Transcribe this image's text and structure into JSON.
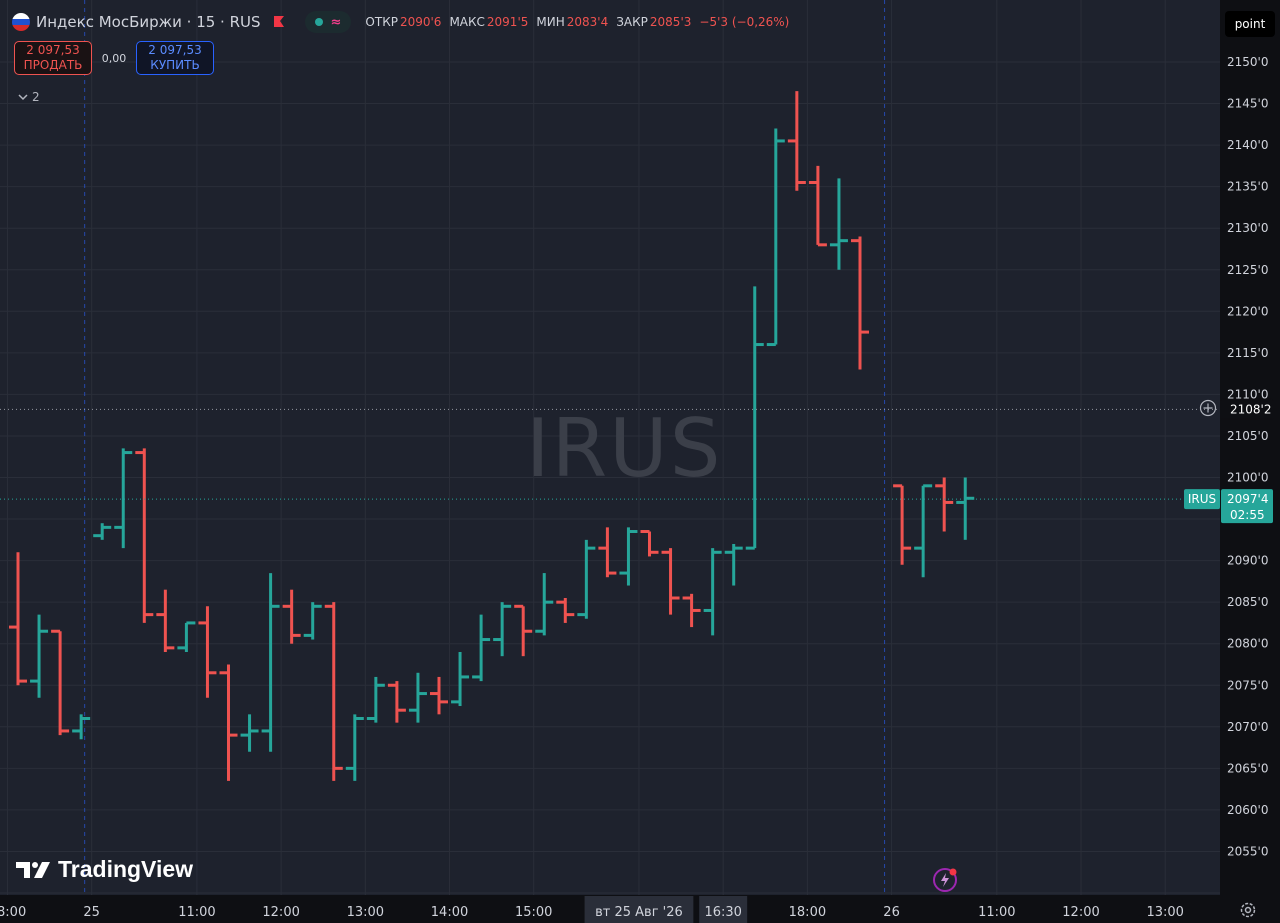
{
  "legend": {
    "title": "Индекс МосБиржи · 15 · RUS",
    "open_label": "ОТКР",
    "open_value": "2090'6",
    "high_label": "МАКС",
    "high_value": "2091'5",
    "low_label": "МИН",
    "low_value": "2083'4",
    "close_label": "ЗАКР",
    "close_value": "2085'3",
    "change": "−5'3 (−0,26%)"
  },
  "trade": {
    "sell_price": "2 097,53",
    "sell_label": "ПРОДАТЬ",
    "spread": "0,00",
    "buy_price": "2 097,53",
    "buy_label": "КУПИТЬ"
  },
  "indicators_toggle": "2",
  "watermark": "IRUS",
  "unit_button": "point",
  "logo_text": "TradingView",
  "colors": {
    "up": "#26a69a",
    "down": "#ef5350",
    "background": "#0e0f13",
    "grid": "#2a2e39",
    "text": "#d1d4dc"
  },
  "chart_data": {
    "type": "ohlc-bar",
    "y_axis": {
      "min": 2051,
      "max": 2152,
      "ticks": [
        2050,
        2055,
        2060,
        2065,
        2070,
        2075,
        2080,
        2085,
        2090,
        2095,
        2100,
        2105,
        2110,
        2115,
        2120,
        2125,
        2130,
        2135,
        2140,
        2145,
        2150
      ],
      "tick_labels": [
        "",
        "2055'0",
        "2060'0",
        "2065'0",
        "2070'0",
        "2075'0",
        "2080'0",
        "2085'0",
        "2090'0",
        "",
        "2100'0",
        "2105'0",
        "2110'0",
        "2115'0",
        "2120'0",
        "2125'0",
        "2130'0",
        "2135'0",
        "2140'0",
        "2145'0",
        "2150'0"
      ]
    },
    "x_axis": {
      "labels": [
        {
          "index": -0.5,
          "text": "18:00"
        },
        {
          "index": 3.5,
          "text": "25"
        },
        {
          "index": 8.5,
          "text": "11:00"
        },
        {
          "index": 12.5,
          "text": "12:00"
        },
        {
          "index": 16.5,
          "text": "13:00"
        },
        {
          "index": 20.5,
          "text": "14:00"
        },
        {
          "index": 24.5,
          "text": "15:00"
        },
        {
          "index": 29.5,
          "text": "вт 25 Авг '26",
          "highlight": true
        },
        {
          "index": 33.5,
          "text": "16:30",
          "highlight": true
        },
        {
          "index": 37.5,
          "text": "18:00"
        },
        {
          "index": 41.5,
          "text": "26"
        },
        {
          "index": 46.5,
          "text": "11:00"
        },
        {
          "index": 50.5,
          "text": "12:00"
        },
        {
          "index": 54.5,
          "text": "13:00"
        }
      ],
      "session_breaks": [
        3.5,
        41.5
      ]
    },
    "bars": [
      {
        "i": 0,
        "o": 2082.0,
        "h": 2091.0,
        "l": 2075.0,
        "c": 2075.5
      },
      {
        "i": 1,
        "o": 2075.5,
        "h": 2083.5,
        "l": 2073.5,
        "c": 2081.5
      },
      {
        "i": 2,
        "o": 2081.5,
        "h": 2081.5,
        "l": 2069.0,
        "c": 2069.5
      },
      {
        "i": 3,
        "o": 2069.5,
        "h": 2071.5,
        "l": 2068.5,
        "c": 2071.0
      },
      {
        "i": 4,
        "o": 2093.0,
        "h": 2094.5,
        "l": 2092.5,
        "c": 2094.0
      },
      {
        "i": 5,
        "o": 2094.0,
        "h": 2103.5,
        "l": 2091.5,
        "c": 2103.0
      },
      {
        "i": 6,
        "o": 2103.0,
        "h": 2103.5,
        "l": 2082.5,
        "c": 2083.5
      },
      {
        "i": 7,
        "o": 2083.5,
        "h": 2086.5,
        "l": 2079.0,
        "c": 2079.5
      },
      {
        "i": 8,
        "o": 2079.5,
        "h": 2082.5,
        "l": 2079.0,
        "c": 2082.5
      },
      {
        "i": 9,
        "o": 2082.5,
        "h": 2084.5,
        "l": 2073.5,
        "c": 2076.5
      },
      {
        "i": 10,
        "o": 2076.5,
        "h": 2077.5,
        "l": 2063.5,
        "c": 2069.0
      },
      {
        "i": 11,
        "o": 2069.0,
        "h": 2071.5,
        "l": 2067.0,
        "c": 2069.5
      },
      {
        "i": 12,
        "o": 2069.5,
        "h": 2088.5,
        "l": 2067.0,
        "c": 2084.5
      },
      {
        "i": 13,
        "o": 2084.5,
        "h": 2086.5,
        "l": 2080.0,
        "c": 2081.0
      },
      {
        "i": 14,
        "o": 2081.0,
        "h": 2085.0,
        "l": 2080.5,
        "c": 2084.5
      },
      {
        "i": 15,
        "o": 2084.5,
        "h": 2085.0,
        "l": 2063.5,
        "c": 2065.0
      },
      {
        "i": 16,
        "o": 2065.0,
        "h": 2071.5,
        "l": 2063.5,
        "c": 2071.0
      },
      {
        "i": 17,
        "o": 2071.0,
        "h": 2076.0,
        "l": 2070.5,
        "c": 2075.0
      },
      {
        "i": 18,
        "o": 2075.0,
        "h": 2075.5,
        "l": 2070.5,
        "c": 2072.0
      },
      {
        "i": 19,
        "o": 2072.0,
        "h": 2076.5,
        "l": 2070.5,
        "c": 2074.0
      },
      {
        "i": 20,
        "o": 2074.0,
        "h": 2076.0,
        "l": 2071.5,
        "c": 2073.0
      },
      {
        "i": 21,
        "o": 2073.0,
        "h": 2079.0,
        "l": 2072.5,
        "c": 2076.0
      },
      {
        "i": 22,
        "o": 2076.0,
        "h": 2083.5,
        "l": 2075.5,
        "c": 2080.5
      },
      {
        "i": 23,
        "o": 2080.5,
        "h": 2085.0,
        "l": 2078.5,
        "c": 2084.5
      },
      {
        "i": 24,
        "o": 2084.5,
        "h": 2084.5,
        "l": 2078.5,
        "c": 2081.5
      },
      {
        "i": 25,
        "o": 2081.5,
        "h": 2088.5,
        "l": 2081.0,
        "c": 2085.0
      },
      {
        "i": 26,
        "o": 2085.0,
        "h": 2085.5,
        "l": 2082.5,
        "c": 2083.5
      },
      {
        "i": 27,
        "o": 2083.5,
        "h": 2092.5,
        "l": 2083.0,
        "c": 2091.5
      },
      {
        "i": 28,
        "o": 2091.5,
        "h": 2094.0,
        "l": 2088.0,
        "c": 2088.5
      },
      {
        "i": 29,
        "o": 2088.5,
        "h": 2094.0,
        "l": 2087.0,
        "c": 2093.5
      },
      {
        "i": 30,
        "o": 2093.5,
        "h": 2093.5,
        "l": 2090.5,
        "c": 2091.0
      },
      {
        "i": 31,
        "o": 2091.0,
        "h": 2091.5,
        "l": 2083.5,
        "c": 2085.5
      },
      {
        "i": 32,
        "o": 2085.5,
        "h": 2086.0,
        "l": 2082.0,
        "c": 2084.0
      },
      {
        "i": 33,
        "o": 2084.0,
        "h": 2091.5,
        "l": 2081.0,
        "c": 2091.0
      },
      {
        "i": 34,
        "o": 2091.0,
        "h": 2092.0,
        "l": 2087.0,
        "c": 2091.5
      },
      {
        "i": 35,
        "o": 2091.5,
        "h": 2123.0,
        "l": 2091.5,
        "c": 2116.0
      },
      {
        "i": 36,
        "o": 2116.0,
        "h": 2142.0,
        "l": 2116.0,
        "c": 2140.5
      },
      {
        "i": 37,
        "o": 2140.5,
        "h": 2146.5,
        "l": 2134.5,
        "c": 2135.5
      },
      {
        "i": 38,
        "o": 2135.5,
        "h": 2137.5,
        "l": 2128.0,
        "c": 2128.0
      },
      {
        "i": 39,
        "o": 2128.0,
        "h": 2136.0,
        "l": 2125.0,
        "c": 2128.5
      },
      {
        "i": 40,
        "o": 2128.5,
        "h": 2129.0,
        "l": 2113.0,
        "c": 2117.5
      },
      {
        "i": 42,
        "o": 2099.0,
        "h": 2099.0,
        "l": 2089.5,
        "c": 2091.5
      },
      {
        "i": 43,
        "o": 2091.5,
        "h": 2099.0,
        "l": 2088.0,
        "c": 2099.0
      },
      {
        "i": 44,
        "o": 2099.0,
        "h": 2100.0,
        "l": 2093.5,
        "c": 2097.0
      },
      {
        "i": 45,
        "o": 2097.0,
        "h": 2100.0,
        "l": 2092.5,
        "c": 2097.5
      }
    ],
    "price_labels": [
      {
        "value": 2097.4,
        "name": "IRUS",
        "text": "2097'4",
        "countdown": "02:55",
        "kind": "last"
      },
      {
        "value": 2108.2,
        "text": "2108'2",
        "kind": "crosshair"
      }
    ]
  }
}
